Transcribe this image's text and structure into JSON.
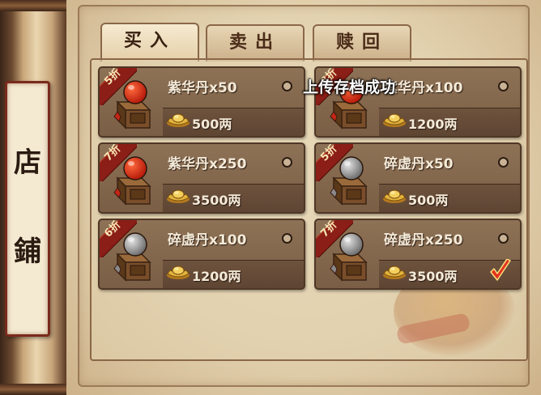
{
  "shop_title": [
    "店",
    "鋪"
  ],
  "tabs": [
    {
      "label": "买入",
      "active": true
    },
    {
      "label": "卖出",
      "active": false
    },
    {
      "label": "赎回",
      "active": false
    }
  ],
  "items": [
    {
      "name": "紫华丹x50",
      "price": "500两",
      "discount": "5折",
      "icon": "red-orb-pedestal-icon",
      "selected": false
    },
    {
      "name": "紫华丹x100",
      "price": "1200两",
      "discount": "8折",
      "icon": "red-orb-pedestal-icon",
      "selected": false
    },
    {
      "name": "紫华丹x250",
      "price": "3500两",
      "discount": "7折",
      "icon": "red-orb-pedestal-icon",
      "selected": false
    },
    {
      "name": "碎虚丹x50",
      "price": "500两",
      "discount": "5折",
      "icon": "grey-orb-pedestal-icon",
      "selected": false
    },
    {
      "name": "碎虚丹x100",
      "price": "1200两",
      "discount": "6折",
      "icon": "grey-orb-pedestal-icon",
      "selected": false
    },
    {
      "name": "碎虚丹x250",
      "price": "3500两",
      "discount": "7折",
      "icon": "grey-orb-pedestal-icon",
      "selected": true
    }
  ],
  "toast": "上传存档成功",
  "colors": {
    "ribbon": "#8b1e16",
    "card": "#7a5e45",
    "checkmark": "#e0321e",
    "gold": "#e3b43c"
  }
}
